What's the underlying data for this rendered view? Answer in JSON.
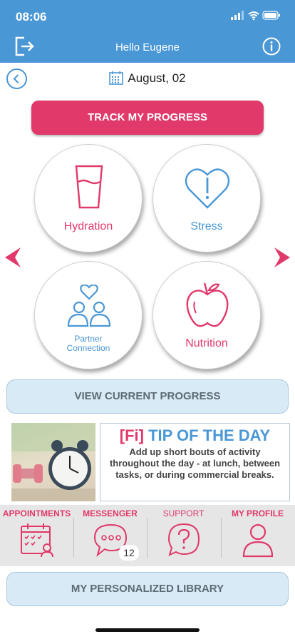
{
  "status_bar": {
    "time": "08:06"
  },
  "header": {
    "title": "Hello Eugene"
  },
  "date_bar": {
    "date": "August, 02"
  },
  "track_button": {
    "label": "TRACK MY PROGRESS"
  },
  "categories": [
    {
      "label": "Hydration",
      "icon": "glass-icon",
      "color": "#e0396a"
    },
    {
      "label": "Stress",
      "icon": "heart-alert-icon",
      "color": "#4a97d6"
    },
    {
      "label": "Partner Connection",
      "line1": "Partner",
      "line2": "Connection",
      "icon": "partner-icon",
      "color": "#4a97d6"
    },
    {
      "label": "Nutrition",
      "icon": "apple-icon",
      "color": "#e0396a"
    }
  ],
  "view_progress_button": {
    "label": "VIEW CURRENT PROGRESS"
  },
  "tip": {
    "logo": "[Fi]",
    "title": "TIP OF THE DAY",
    "text": "Add up short bouts of activity throughout the day - at lunch, between tasks, or during commercial breaks."
  },
  "bottom_nav": [
    {
      "label": "APPOINTMENTS",
      "icon": "calendar-user-icon"
    },
    {
      "label": "MESSENGER",
      "icon": "chat-bubble-icon",
      "badge": "12"
    },
    {
      "label": "SUPPORT",
      "icon": "question-bubble-icon"
    },
    {
      "label": "MY PROFILE",
      "icon": "profile-icon"
    }
  ],
  "library_button": {
    "label": "MY PERSONALIZED LIBRARY"
  },
  "colors": {
    "header": "#4a97d6",
    "accent": "#e0396a",
    "pill": "#d8eaf6"
  }
}
